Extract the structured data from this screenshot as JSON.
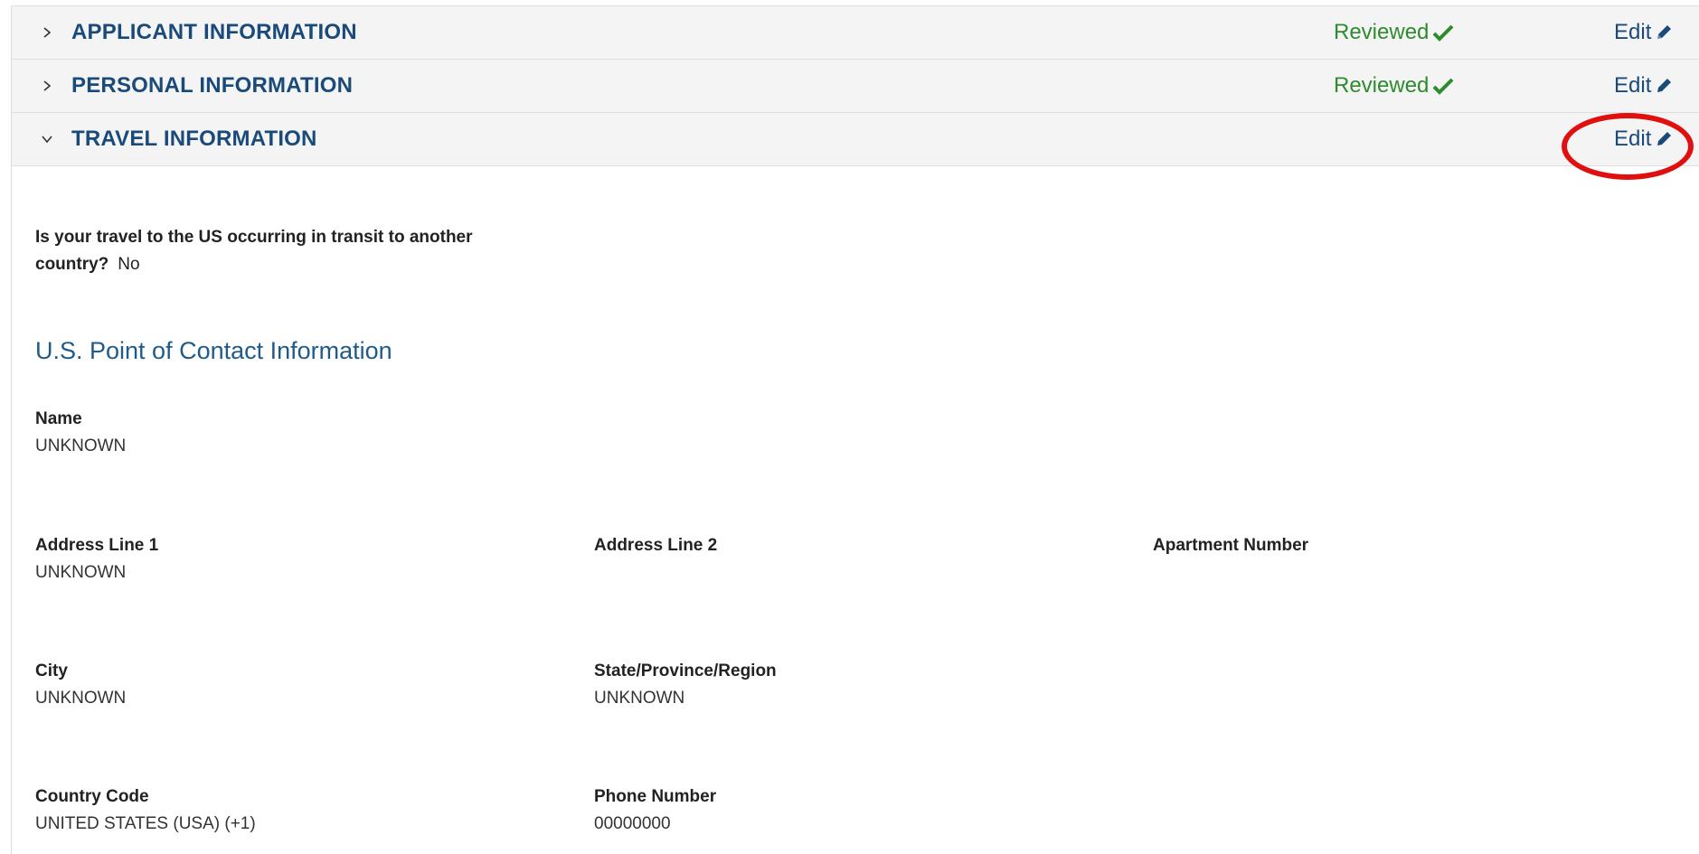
{
  "sections": [
    {
      "title": "APPLICANT INFORMATION",
      "status": "Reviewed",
      "edit_label": "Edit",
      "expanded": false
    },
    {
      "title": "PERSONAL INFORMATION",
      "status": "Reviewed",
      "edit_label": "Edit",
      "expanded": false
    },
    {
      "title": "TRAVEL INFORMATION",
      "status": "",
      "edit_label": "Edit",
      "expanded": true
    }
  ],
  "travel": {
    "transit_question": "Is your travel to the US occurring in transit to another country?",
    "transit_answer": "No",
    "poc_heading": "U.S. Point of Contact Information",
    "fields": {
      "name": {
        "label": "Name",
        "value": "UNKNOWN"
      },
      "address1": {
        "label": "Address Line 1",
        "value": "UNKNOWN"
      },
      "address2": {
        "label": "Address Line 2",
        "value": ""
      },
      "apartment": {
        "label": "Apartment Number",
        "value": ""
      },
      "city": {
        "label": "City",
        "value": "UNKNOWN"
      },
      "state": {
        "label": "State/Province/Region",
        "value": "UNKNOWN"
      },
      "country_code": {
        "label": "Country Code",
        "value": "UNITED STATES (USA) (+1)"
      },
      "phone": {
        "label": "Phone Number",
        "value": "00000000"
      }
    }
  },
  "colors": {
    "title": "#1a4a7a",
    "reviewed": "#2e8b2e",
    "heading": "#1f5b8a",
    "highlight": "#e01010",
    "header_bg": "#f4f4f4"
  },
  "icons": {
    "collapsed": "chevron-right-icon",
    "expanded": "chevron-down-icon",
    "reviewed": "checkmark-icon",
    "edit": "pencil-icon"
  }
}
